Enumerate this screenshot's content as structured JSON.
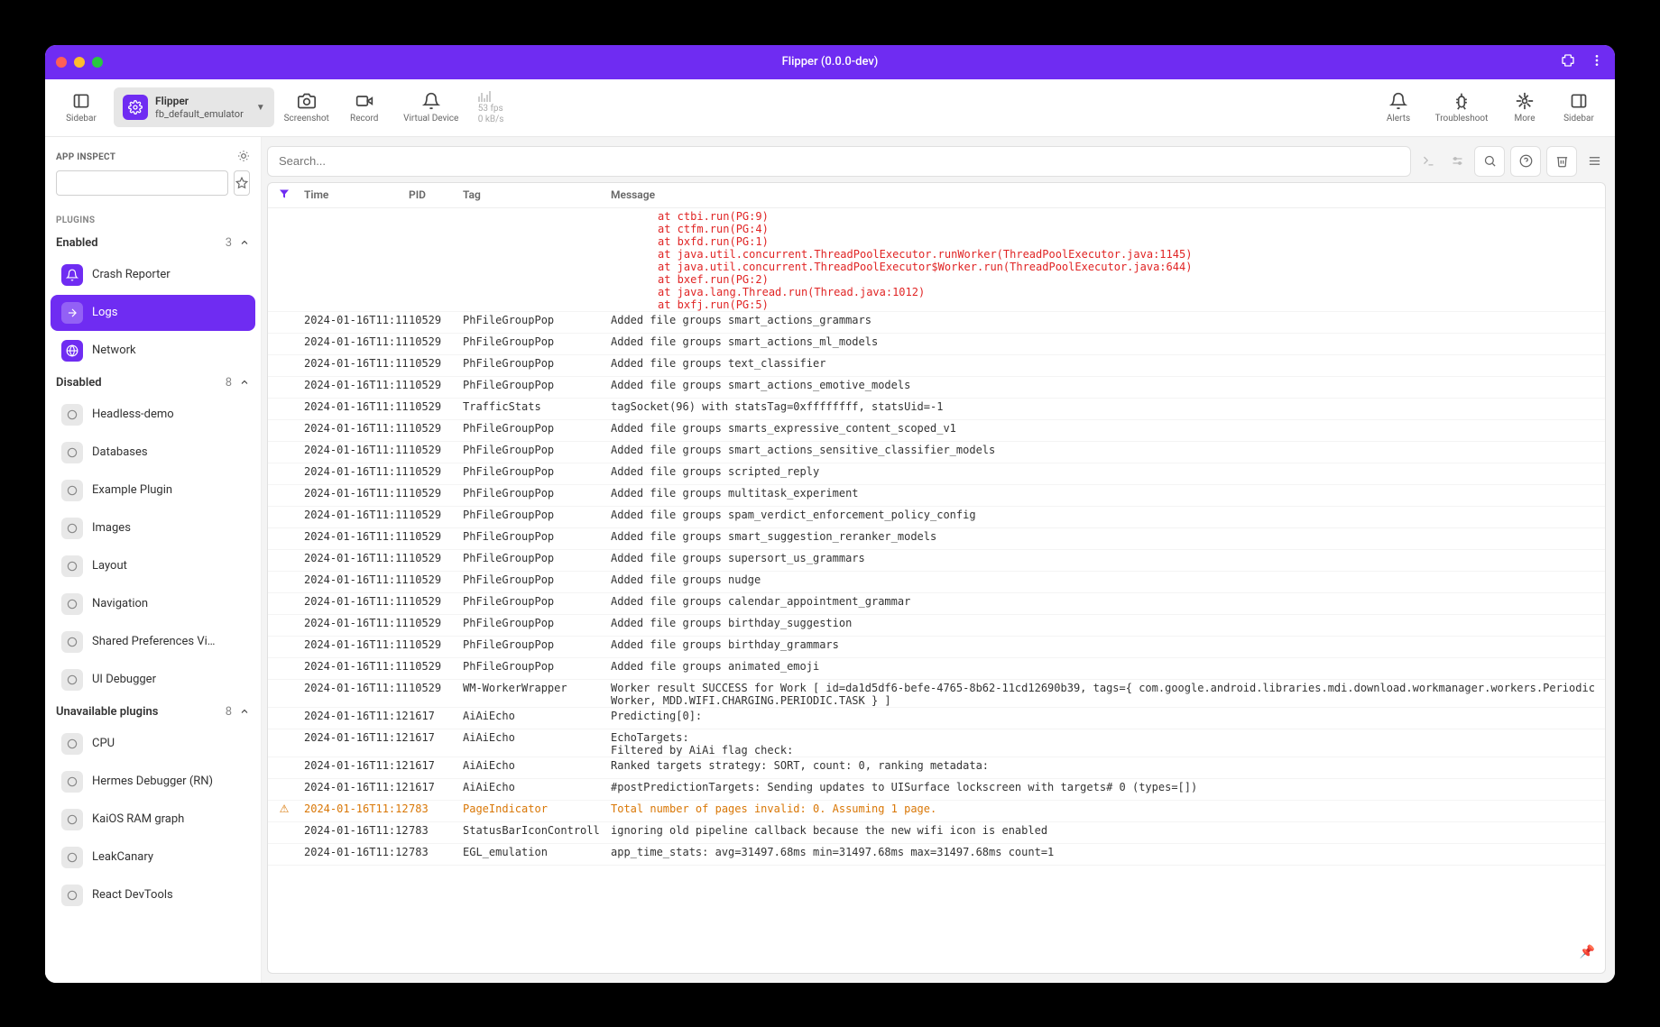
{
  "window_title": "Flipper (0.0.0-dev)",
  "toolbar": {
    "sidebar_label": "Sidebar",
    "device": {
      "name": "Flipper",
      "sub": "fb_default_emulator"
    },
    "screenshot": "Screenshot",
    "record": "Record",
    "virtual_device": "Virtual Device",
    "stats": {
      "fps": "53 fps",
      "kb": "0 kB/s"
    },
    "alerts": "Alerts",
    "troubleshoot": "Troubleshoot",
    "more": "More",
    "sidebar2": "Sidebar"
  },
  "sidebar": {
    "inspect_label": "APP INSPECT",
    "plugins_label": "PLUGINS",
    "groups": [
      {
        "name": "Enabled",
        "count": "3"
      },
      {
        "name": "Disabled",
        "count": "8"
      },
      {
        "name": "Unavailable plugins",
        "count": "8"
      }
    ],
    "enabled": [
      "Crash Reporter",
      "Logs",
      "Network"
    ],
    "disabled": [
      "Headless-demo",
      "Databases",
      "Example Plugin",
      "Images",
      "Layout",
      "Navigation",
      "Shared Preferences Vi…",
      "UI Debugger"
    ],
    "unavailable": [
      "CPU",
      "Hermes Debugger (RN)",
      "KaiOS RAM graph",
      "LeakCanary",
      "React DevTools"
    ]
  },
  "search": {
    "placeholder": "Search..."
  },
  "columns": {
    "time": "Time",
    "pid": "PID",
    "tag": "Tag",
    "msg": "Message"
  },
  "stacktrace": [
    "at ctbi.run(PG:9)",
    "at ctfm.run(PG:4)",
    "at bxfd.run(PG:1)",
    "at java.util.concurrent.ThreadPoolExecutor.runWorker(ThreadPoolExecutor.java:1145)",
    "at java.util.concurrent.ThreadPoolExecutor$Worker.run(ThreadPoolExecutor.java:644)",
    "at bxef.run(PG:2)",
    "at java.lang.Thread.run(Thread.java:1012)",
    "at bxfj.run(PG:5)"
  ],
  "logs": [
    {
      "time": "2024-01-16T11:11",
      "pid": "10529",
      "tag": "PhFileGroupPop",
      "msg": "Added file groups smart_actions_grammars"
    },
    {
      "time": "2024-01-16T11:11",
      "pid": "10529",
      "tag": "PhFileGroupPop",
      "msg": "Added file groups smart_actions_ml_models"
    },
    {
      "time": "2024-01-16T11:11",
      "pid": "10529",
      "tag": "PhFileGroupPop",
      "msg": "Added file groups text_classifier"
    },
    {
      "time": "2024-01-16T11:11",
      "pid": "10529",
      "tag": "PhFileGroupPop",
      "msg": "Added file groups smart_actions_emotive_models"
    },
    {
      "time": "2024-01-16T11:11",
      "pid": "10529",
      "tag": "TrafficStats",
      "msg": "tagSocket(96) with statsTag=0xffffffff, statsUid=-1"
    },
    {
      "time": "2024-01-16T11:11",
      "pid": "10529",
      "tag": "PhFileGroupPop",
      "msg": "Added file groups smarts_expressive_content_scoped_v1"
    },
    {
      "time": "2024-01-16T11:11",
      "pid": "10529",
      "tag": "PhFileGroupPop",
      "msg": "Added file groups smart_actions_sensitive_classifier_models"
    },
    {
      "time": "2024-01-16T11:11",
      "pid": "10529",
      "tag": "PhFileGroupPop",
      "msg": "Added file groups scripted_reply"
    },
    {
      "time": "2024-01-16T11:11",
      "pid": "10529",
      "tag": "PhFileGroupPop",
      "msg": "Added file groups multitask_experiment"
    },
    {
      "time": "2024-01-16T11:11",
      "pid": "10529",
      "tag": "PhFileGroupPop",
      "msg": "Added file groups spam_verdict_enforcement_policy_config"
    },
    {
      "time": "2024-01-16T11:11",
      "pid": "10529",
      "tag": "PhFileGroupPop",
      "msg": "Added file groups smart_suggestion_reranker_models"
    },
    {
      "time": "2024-01-16T11:11",
      "pid": "10529",
      "tag": "PhFileGroupPop",
      "msg": "Added file groups supersort_us_grammars"
    },
    {
      "time": "2024-01-16T11:11",
      "pid": "10529",
      "tag": "PhFileGroupPop",
      "msg": "Added file groups nudge"
    },
    {
      "time": "2024-01-16T11:11",
      "pid": "10529",
      "tag": "PhFileGroupPop",
      "msg": "Added file groups calendar_appointment_grammar"
    },
    {
      "time": "2024-01-16T11:11",
      "pid": "10529",
      "tag": "PhFileGroupPop",
      "msg": "Added file groups birthday_suggestion"
    },
    {
      "time": "2024-01-16T11:11",
      "pid": "10529",
      "tag": "PhFileGroupPop",
      "msg": "Added file groups birthday_grammars"
    },
    {
      "time": "2024-01-16T11:11",
      "pid": "10529",
      "tag": "PhFileGroupPop",
      "msg": "Added file groups animated_emoji"
    },
    {
      "time": "2024-01-16T11:11",
      "pid": "10529",
      "tag": "WM-WorkerWrapper",
      "msg": "Worker result SUCCESS for Work [ id=da1d5df6-befe-4765-8b62-11cd12690b39, tags={ com.google.android.libraries.mdi.download.workmanager.workers.PeriodicWorker, MDD.WIFI.CHARGING.PERIODIC.TASK } ]"
    },
    {
      "time": "2024-01-16T11:12",
      "pid": "1617",
      "tag": "AiAiEcho",
      "msg": "Predicting[0]:"
    },
    {
      "time": "2024-01-16T11:12",
      "pid": "1617",
      "tag": "AiAiEcho",
      "msg": "EchoTargets:\nFiltered by AiAi flag check:"
    },
    {
      "time": "2024-01-16T11:12",
      "pid": "1617",
      "tag": "AiAiEcho",
      "msg": "Ranked targets strategy: SORT, count: 0, ranking metadata:"
    },
    {
      "time": "2024-01-16T11:12",
      "pid": "1617",
      "tag": "AiAiEcho",
      "msg": "#postPredictionTargets: Sending updates to UISurface lockscreen with targets# 0 (types=[])"
    },
    {
      "time": "2024-01-16T11:12",
      "pid": "783",
      "tag": "PageIndicator",
      "msg": "Total number of pages invalid: 0. Assuming 1 page.",
      "level": "warn"
    },
    {
      "time": "2024-01-16T11:12",
      "pid": "783",
      "tag": "StatusBarIconControll",
      "msg": "ignoring old pipeline callback because the new wifi icon is enabled"
    },
    {
      "time": "2024-01-16T11:12",
      "pid": "783",
      "tag": "EGL_emulation",
      "msg": "app_time_stats: avg=31497.68ms min=31497.68ms max=31497.68ms count=1"
    }
  ]
}
